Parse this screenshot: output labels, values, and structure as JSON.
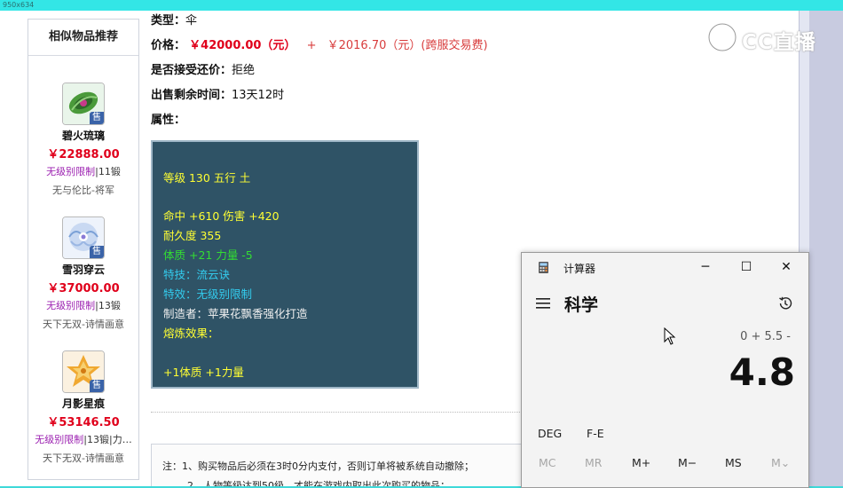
{
  "window_size_label": "950x634",
  "sidebar": {
    "title": "相似物品推荐",
    "items": [
      {
        "name": "碧火琉璃",
        "price": "￥22888.00",
        "tag": "无级别限制",
        "level": "11锻",
        "server": "无与伦比-将军",
        "badge": "售"
      },
      {
        "name": "雪羽穿云",
        "price": "￥37000.00",
        "tag": "无级别限制",
        "level": "13锻",
        "server": "天下无双-诗情画意",
        "badge": "售"
      },
      {
        "name": "月影星痕",
        "price": "￥53146.50",
        "tag": "无级别限制",
        "level": "13锻",
        "extra": "力…",
        "server": "天下无双-诗情画意",
        "badge": "售"
      }
    ]
  },
  "detail": {
    "type_label": "类型：",
    "type_value": "伞",
    "price_label": "价格：",
    "price_main": "￥42000.00（元）",
    "price_plus": "+",
    "price_fee": "￥2016.70（元）(跨服交易费)",
    "bargain_label": "是否接受还价：",
    "bargain_value": "拒绝",
    "time_label": "出售剩余时间：",
    "time_value": "13天12时",
    "attr_label": "属性："
  },
  "attributes": {
    "level_line": "等级 130 五行 土",
    "hit_line": "命中 +610 伤害 +420",
    "durability_line": "耐久度 355",
    "bonus_line": "体质 +21 力量 -5",
    "skill_line": "特技：流云诀",
    "effect_line": "特效：无级别限制",
    "maker_line": "制造者：苹果花飘香强化打造",
    "refine_label": "熔炼效果：",
    "refine_value": "+1体质 +1力量"
  },
  "notes": {
    "line1": "注：1、购买物品后必须在3时0分内支付，否则订单将被系统自动撤除；",
    "line2": "2、人物等级达到50级，才能在游戏内取出此次购买的物品；"
  },
  "watermark": {
    "text": "CC直播"
  },
  "calculator": {
    "app_title": "计算器",
    "mode": "科学",
    "expression": "0 + 5.5 -",
    "display": "4.8",
    "angle_mode": "DEG",
    "fe_label": "F-E",
    "memory": [
      "MC",
      "MR",
      "M+",
      "M−",
      "MS",
      "M⌄"
    ],
    "controls": {
      "minimize": "─",
      "maximize": "☐",
      "close": "✕"
    }
  },
  "colors": {
    "price_red": "#e0001b",
    "attr_bg": "#2f5366",
    "attr_yellow": "#ffff33",
    "attr_green": "#33dd33",
    "attr_cyan": "#33ccee",
    "limit_purple": "#9b1fb0"
  }
}
